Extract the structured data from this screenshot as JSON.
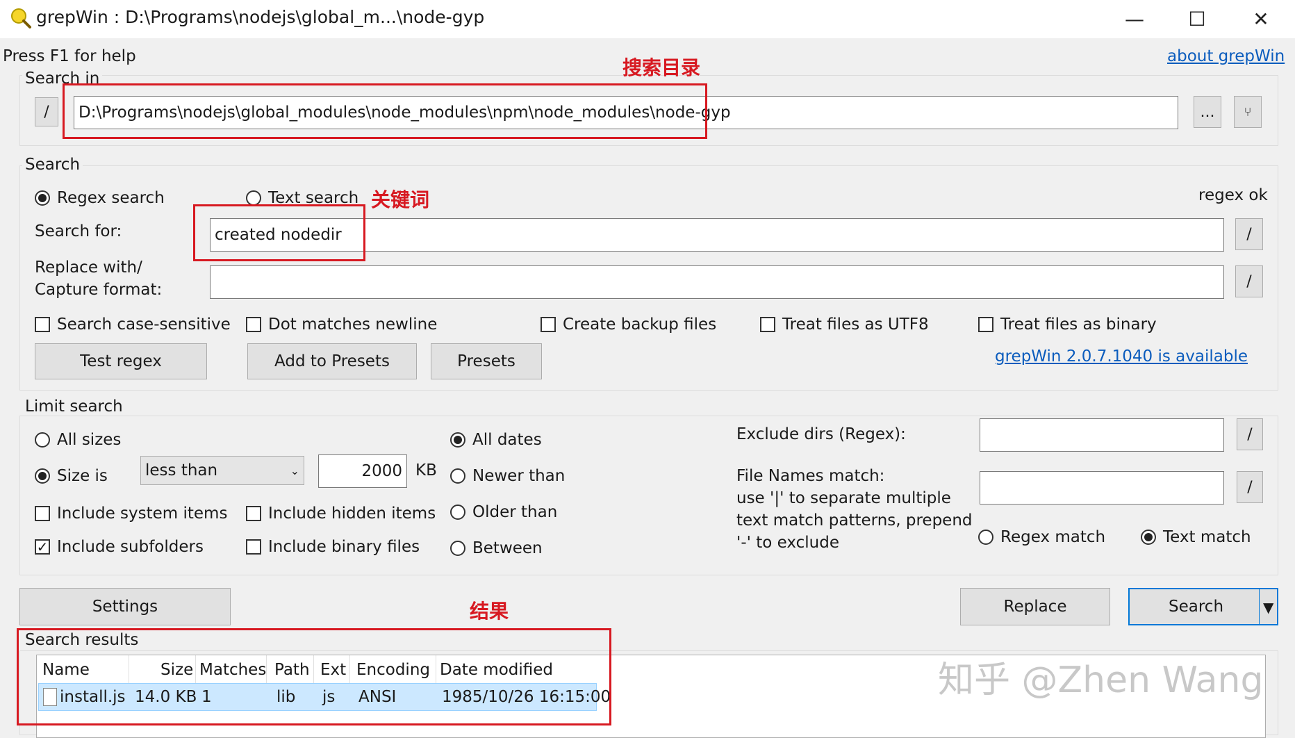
{
  "window": {
    "title": "grepWin : D:\\Programs\\nodejs\\global_m...\\node-gyp",
    "minimize_glyph": "—",
    "maximize_glyph": "☐",
    "close_glyph": "✕"
  },
  "header": {
    "help_text": "Press F1 for help",
    "about_link": "about grepWin"
  },
  "search_in": {
    "group_label": "Search in",
    "slash_btn": "/",
    "path_value": "D:\\Programs\\nodejs\\global_modules\\node_modules\\npm\\node_modules\\node-gyp",
    "browse_btn": "...",
    "up_btn": "⑂"
  },
  "search": {
    "group_label": "Search",
    "regex_label": "Regex search",
    "text_label": "Text search",
    "status": "regex ok",
    "search_for_label": "Search for:",
    "search_for_value": "created nodedir",
    "replace_label_line1": "Replace with/",
    "replace_label_line2": "Capture format:",
    "replace_value": "",
    "slash_btn": "/",
    "case_sensitive": "Search case-sensitive",
    "dot_newline": "Dot matches newline",
    "backup": "Create backup files",
    "utf8": "Treat files as UTF8",
    "binary": "Treat files as binary",
    "test_regex_btn": "Test regex",
    "add_presets_btn": "Add to Presets",
    "presets_btn": "Presets",
    "update_link": "grepWin 2.0.7.1040 is available"
  },
  "limit": {
    "group_label": "Limit search",
    "all_sizes": "All sizes",
    "size_is": "Size is",
    "size_op": "less than",
    "size_value": "2000",
    "size_unit": "KB",
    "all_dates": "All dates",
    "newer": "Newer than",
    "older": "Older than",
    "between": "Between",
    "include_system": "Include system items",
    "include_hidden": "Include hidden items",
    "include_subfolders": "Include subfolders",
    "include_binary": "Include binary files",
    "exclude_dirs_label": "Exclude dirs (Regex):",
    "exclude_dirs_value": "",
    "filenames_line1": "File Names match:",
    "filenames_line2": "use '|' to separate multiple",
    "filenames_line3": "text match patterns, prepend",
    "filenames_line4": "'-' to exclude",
    "filenames_value": "",
    "regex_match": "Regex match",
    "text_match": "Text match",
    "slash_btn": "/"
  },
  "actions": {
    "settings_btn": "Settings",
    "replace_btn": "Replace",
    "search_btn": "Search"
  },
  "results": {
    "group_label": "Search results",
    "columns": [
      "Name",
      "Size",
      "Matches",
      "Path",
      "Ext",
      "Encoding",
      "Date modified"
    ],
    "rows": [
      {
        "name": "install.js",
        "size": "14.0 KB",
        "matches": "1",
        "path": "lib",
        "ext": "js",
        "encoding": "ANSI",
        "date": "1985/10/26 16:15:00"
      }
    ]
  },
  "annotations": {
    "search_dir": "搜索目录",
    "keyword": "关键词",
    "result": "结果"
  },
  "watermark": "知乎 @Zhen Wang",
  "colors": {
    "annotation_red": "#d71921",
    "link_blue": "#0b5cbd",
    "selected_row": "#cce8ff"
  }
}
